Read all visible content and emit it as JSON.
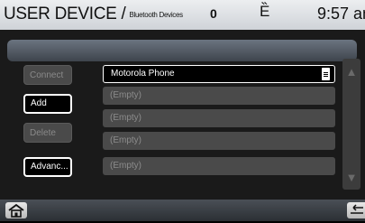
{
  "header": {
    "title": "USER DEVICE /",
    "subtitle": "Bluetooth Devices",
    "count": "0",
    "status_glyph": "Ȅ",
    "clock": "9:57 am"
  },
  "buttons": {
    "connect": "Connect",
    "add": "Add",
    "delete": "Delete",
    "advanced": "Advanc..."
  },
  "devices": [
    {
      "label": "Motorola Phone"
    },
    {
      "label": "(Empty)"
    },
    {
      "label": "(Empty)"
    },
    {
      "label": "(Empty)"
    },
    {
      "label": "(Empty)"
    }
  ],
  "icons": {
    "home": "home-icon",
    "back": "back-arrow-icon",
    "scroll_up": "scroll-up-icon",
    "scroll_down": "scroll-down-icon",
    "phone": "phone-icon"
  }
}
